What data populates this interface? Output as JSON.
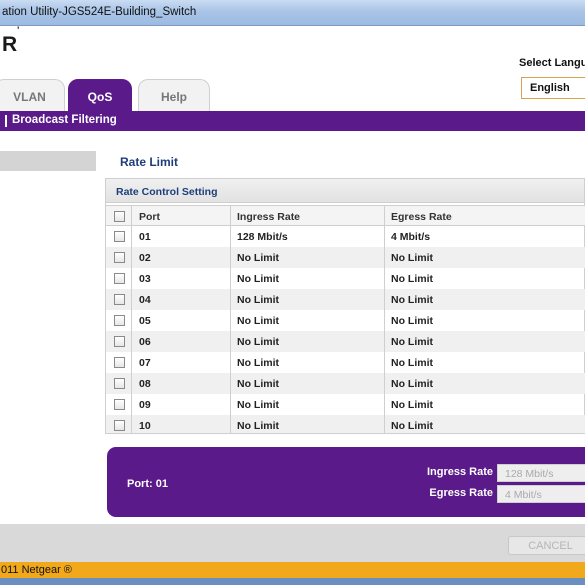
{
  "window": {
    "title": "ation Utility-JGS524E-Building_Switch"
  },
  "brand": {
    "logo_text": "R",
    "logo_mark": "'"
  },
  "language": {
    "label": "Select Langua",
    "selected": "English"
  },
  "tabs": [
    {
      "label": "VLAN",
      "active": false
    },
    {
      "label": "QoS",
      "active": true
    },
    {
      "label": "Help",
      "active": false
    }
  ],
  "subnav": {
    "item": "Broadcast Filtering"
  },
  "section": {
    "title": "Rate Limit"
  },
  "panel": {
    "title": "Rate Control Setting"
  },
  "table": {
    "columns": [
      "Port",
      "Ingress Rate",
      "Egress Rate"
    ],
    "rows": [
      {
        "port": "01",
        "ingress": "128 Mbit/s",
        "egress": "4 Mbit/s"
      },
      {
        "port": "02",
        "ingress": "No Limit",
        "egress": "No Limit"
      },
      {
        "port": "03",
        "ingress": "No Limit",
        "egress": "No Limit"
      },
      {
        "port": "04",
        "ingress": "No Limit",
        "egress": "No Limit"
      },
      {
        "port": "05",
        "ingress": "No Limit",
        "egress": "No Limit"
      },
      {
        "port": "06",
        "ingress": "No Limit",
        "egress": "No Limit"
      },
      {
        "port": "07",
        "ingress": "No Limit",
        "egress": "No Limit"
      },
      {
        "port": "08",
        "ingress": "No Limit",
        "egress": "No Limit"
      },
      {
        "port": "09",
        "ingress": "No Limit",
        "egress": "No Limit"
      },
      {
        "port": "10",
        "ingress": "No Limit",
        "egress": "No Limit"
      }
    ]
  },
  "detail": {
    "port_text": "Port: 01",
    "ingress_label": "Ingress Rate",
    "ingress_value": "128 Mbit/s",
    "egress_label": "Egress Rate",
    "egress_value": "4 Mbit/s"
  },
  "actions": {
    "cancel_label": "CANCEL"
  },
  "footer": {
    "copyright": "011 Netgear ®"
  },
  "colors": {
    "accent": "#5b1a8a",
    "footer": "#f1a81a",
    "heading": "#1e3d7a"
  }
}
